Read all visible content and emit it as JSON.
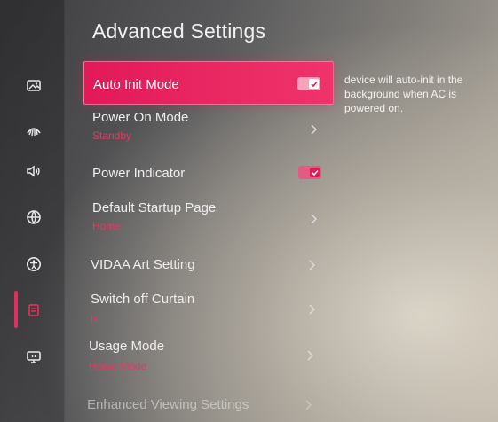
{
  "page": {
    "title": "Advanced Settings",
    "description": "device will auto-init in the background when AC is powered on."
  },
  "colors": {
    "accent": "#e2195a",
    "value_text": "#e23a62"
  },
  "sidebar": {
    "items": [
      {
        "icon": "picture-icon"
      },
      {
        "icon": "sound-wave-icon"
      },
      {
        "icon": "speaker-icon"
      },
      {
        "icon": "network-globe-icon"
      },
      {
        "icon": "accessibility-icon"
      },
      {
        "icon": "system-icon",
        "active": true
      },
      {
        "icon": "support-icon"
      }
    ]
  },
  "settings": [
    {
      "label": "Auto Init Mode",
      "control": "toggle",
      "checked": true,
      "focused": true
    },
    {
      "label": "Power On Mode",
      "value": "Standby",
      "control": "chevron"
    },
    {
      "label": "Power Indicator",
      "control": "toggle",
      "checked": true
    },
    {
      "label": "Default Startup Page",
      "value": "Home",
      "control": "chevron"
    },
    {
      "label": "VIDAA Art Setting",
      "control": "chevron"
    },
    {
      "label": "Switch off Curtain",
      "value": "ls",
      "control": "chevron"
    },
    {
      "label": "Usage Mode",
      "value": "Home Mode",
      "control": "chevron"
    },
    {
      "label": "Enhanced Viewing Settings",
      "control": "chevron"
    }
  ]
}
